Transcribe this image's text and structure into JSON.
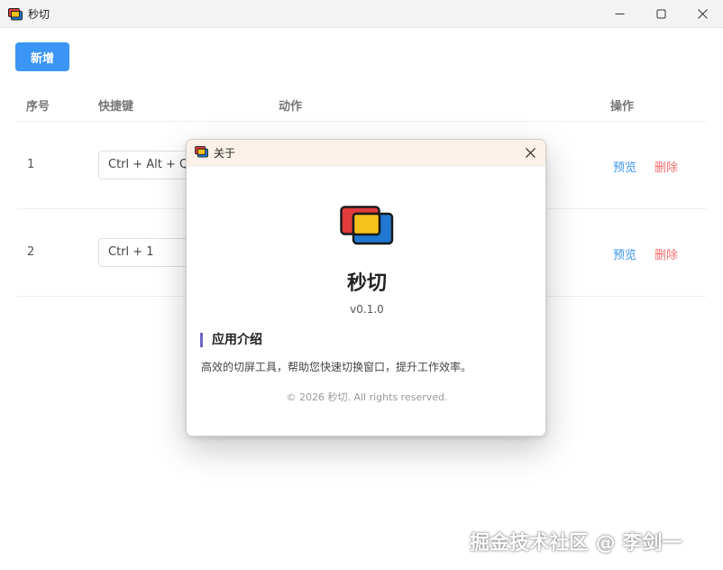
{
  "window": {
    "title": "秒切"
  },
  "toolbar": {
    "add_label": "新增"
  },
  "table": {
    "headers": {
      "index": "序号",
      "hotkey": "快捷键",
      "action": "动作",
      "operation": "操作"
    },
    "rows": [
      {
        "index": "1",
        "hotkey": "Ctrl + Alt + Q",
        "preview": "预览",
        "delete": "删除"
      },
      {
        "index": "2",
        "hotkey": "Ctrl + 1",
        "preview": "预览",
        "delete": "删除"
      }
    ]
  },
  "dialog": {
    "title": "关于",
    "app_name": "秒切",
    "version": "v0.1.0",
    "section_title": "应用介绍",
    "intro": "高效的切屏工具，帮助您快速切换窗口，提升工作效率。",
    "copyright": "© 2026 秒切. All rights reserved."
  },
  "watermark": "掘金技术社区 @ 李剑一",
  "icons": {
    "app": "app-windows-icon",
    "minimize": "minimize-icon",
    "maximize": "maximize-icon",
    "close": "close-icon"
  },
  "colors": {
    "accent": "#3a95f5",
    "danger": "#f56c6c",
    "dialog_header": "#fbf1e8",
    "section_bar": "#6b68c4",
    "logo_red": "#e23b3b",
    "logo_yellow": "#f5c21b",
    "logo_blue": "#1f78d1"
  }
}
